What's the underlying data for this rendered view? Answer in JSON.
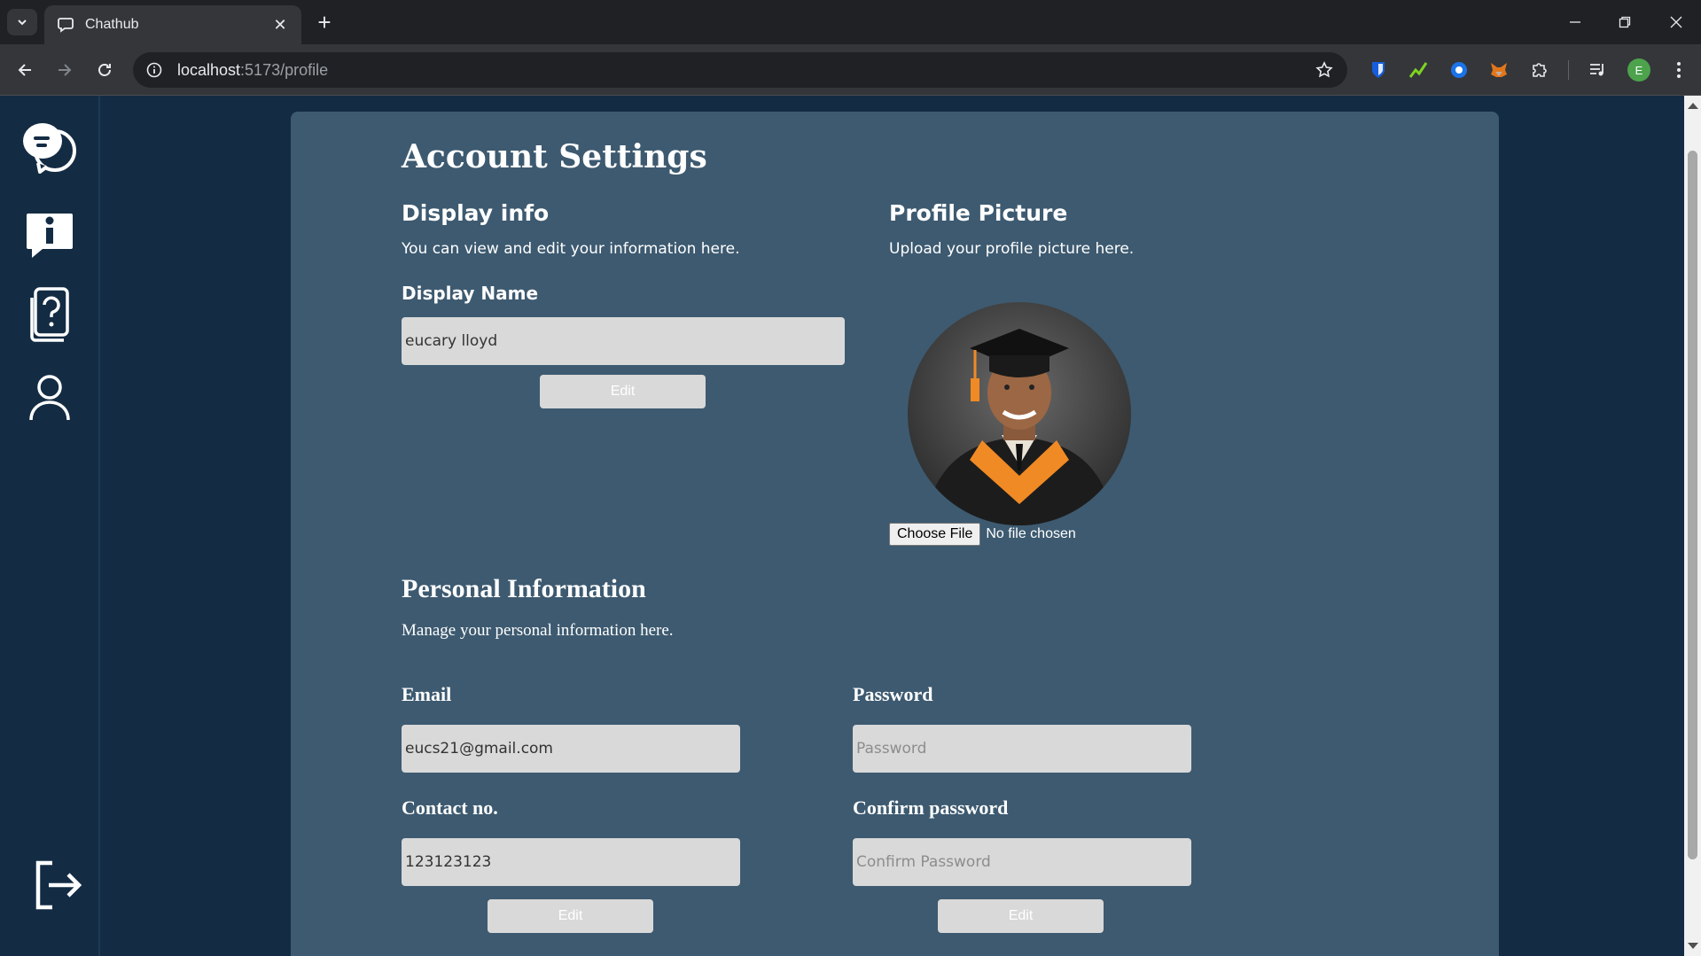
{
  "browser": {
    "tab_title": "Chathub",
    "url_host": "localhost",
    "url_path": ":5173/profile",
    "profile_initial": "E"
  },
  "page": {
    "title": "Account Settings",
    "display_info": {
      "heading": "Display info",
      "description": "You can view and edit your information here.",
      "name_label": "Display Name",
      "name_value": "eucary lloyd",
      "edit_label": "Edit"
    },
    "profile_picture": {
      "heading": "Profile Picture",
      "description": "Upload your profile picture here.",
      "choose_file_label": "Choose File",
      "file_status": "No file chosen"
    },
    "personal_info": {
      "heading": "Personal Information",
      "description": "Manage your personal information here.",
      "email_label": "Email",
      "email_value": "eucs21@gmail.com",
      "password_label": "Password",
      "password_placeholder": "Password",
      "contact_label": "Contact no.",
      "contact_value": "123123123",
      "confirm_label": "Confirm password",
      "confirm_placeholder": "Confirm Password",
      "edit_left_label": "Edit",
      "edit_right_label": "Edit"
    }
  },
  "sidebar": {
    "items": [
      {
        "icon": "chat-bubble-icon"
      },
      {
        "icon": "info-icon"
      },
      {
        "icon": "help-cards-icon"
      },
      {
        "icon": "user-icon"
      },
      {
        "icon": "logout-icon"
      }
    ]
  },
  "colors": {
    "app_bg": "#132c44",
    "card_bg": "#3d5a70",
    "input_bg": "#d9d9d9",
    "text": "#ffffff"
  }
}
